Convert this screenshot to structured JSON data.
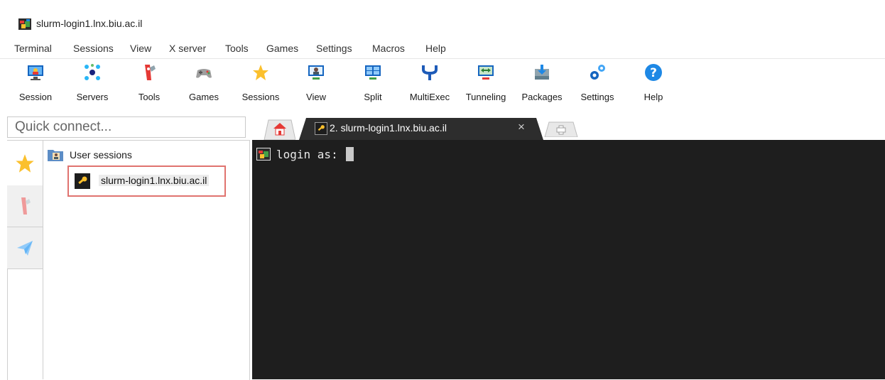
{
  "window": {
    "title": "slurm-login1.lnx.biu.ac.il"
  },
  "menu": [
    "Terminal",
    "Sessions",
    "View",
    "X server",
    "Tools",
    "Games",
    "Settings",
    "Macros",
    "Help"
  ],
  "toolbar": [
    {
      "label": "Session",
      "icon": "session-icon"
    },
    {
      "label": "Servers",
      "icon": "servers-icon"
    },
    {
      "label": "Tools",
      "icon": "tools-icon"
    },
    {
      "label": "Games",
      "icon": "games-icon"
    },
    {
      "label": "Sessions",
      "icon": "star-icon"
    },
    {
      "label": "View",
      "icon": "view-icon"
    },
    {
      "label": "Split",
      "icon": "split-icon"
    },
    {
      "label": "MultiExec",
      "icon": "multiexec-icon"
    },
    {
      "label": "Tunneling",
      "icon": "tunneling-icon"
    },
    {
      "label": "Packages",
      "icon": "packages-icon"
    },
    {
      "label": "Settings",
      "icon": "settings-icon"
    },
    {
      "label": "Help",
      "icon": "help-icon"
    }
  ],
  "quick_connect": {
    "placeholder": "Quick connect..."
  },
  "sidebar": {
    "root_label": "User sessions",
    "sessions": [
      {
        "label": "slurm-login1.lnx.biu.ac.il"
      }
    ]
  },
  "tabs": {
    "active_label": "2. slurm-login1.lnx.biu.ac.il",
    "close_glyph": "×"
  },
  "terminal": {
    "prompt": "login as: "
  },
  "colors": {
    "terminal_bg": "#1e1e1e",
    "tab_active_bg": "#2d2d2d",
    "accent_blue": "#1e88e5",
    "highlight_border": "#e0736f"
  }
}
